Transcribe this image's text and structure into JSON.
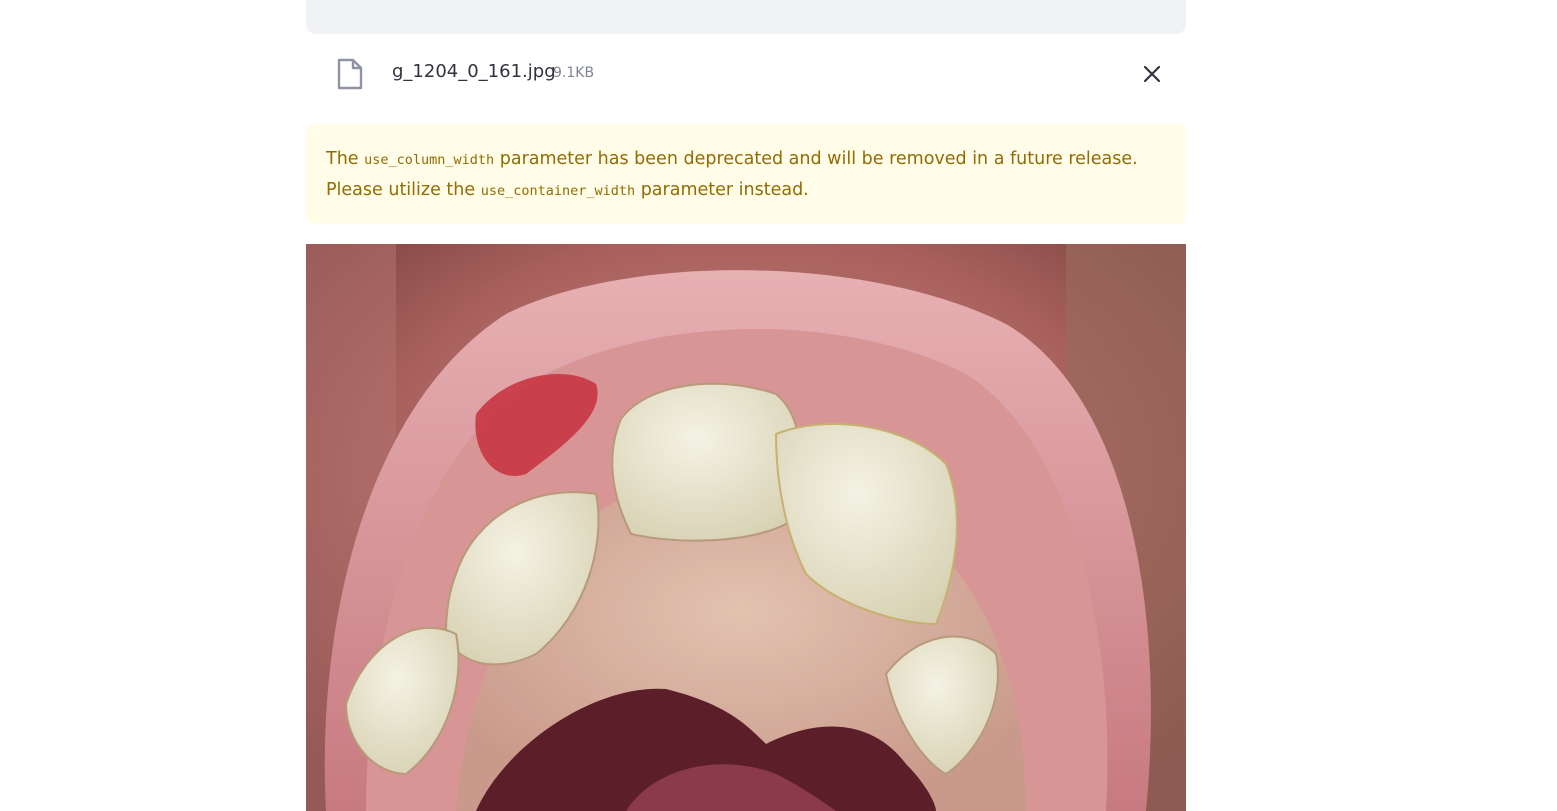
{
  "uploader": {
    "file_name": "g_1204_0_161.jpg",
    "file_size": "9.1KB",
    "file_icon": "file-icon",
    "remove_icon": "close-icon"
  },
  "alert": {
    "text_1": "The ",
    "code_1": "use_column_width",
    "text_2": " parameter has been deprecated and will be removed in a future release. Please utilize the ",
    "code_2": "use_container_width",
    "text_3": " parameter instead."
  },
  "image": {
    "subject": "close-up photo of open mouth showing upper teeth and palate"
  },
  "colors": {
    "alert_bg": "#fffce7",
    "alert_text": "#926c05",
    "dropzone_bg": "#f0f2f6"
  }
}
